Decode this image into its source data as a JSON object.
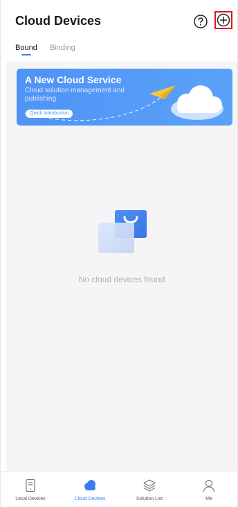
{
  "header": {
    "title": "Cloud Devices"
  },
  "tabs": [
    {
      "label": "Bound",
      "active": true
    },
    {
      "label": "Binding",
      "active": false
    }
  ],
  "banner": {
    "title": "A New Cloud Service",
    "subtitle": "Cloud solution management and publishing",
    "button_label": "Quick Introduction"
  },
  "empty_state": {
    "message": "No cloud devices found"
  },
  "bottom_nav": [
    {
      "label": "Local Devices",
      "icon": "device-icon",
      "active": false
    },
    {
      "label": "Cloud Devices",
      "icon": "cloud-icon",
      "active": true
    },
    {
      "label": "Solution List",
      "icon": "layers-icon",
      "active": false
    },
    {
      "label": "Me",
      "icon": "person-icon",
      "active": false
    }
  ],
  "colors": {
    "accent": "#3c7cf0",
    "banner": "#4f93f6",
    "highlight_box": "#e0141b",
    "content_background": "#f5f5f7"
  }
}
